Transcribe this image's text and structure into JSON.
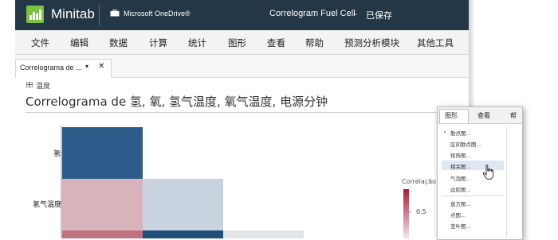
{
  "titlebar": {
    "brand": "Minitab",
    "cloud_label": "Microsoft OneDrive®",
    "doc_title": "Correlogram Fuel Cell",
    "sep": "-",
    "doc_status": "已保存"
  },
  "menu": [
    "文件",
    "编辑",
    "数据",
    "计算",
    "统计",
    "图形",
    "查看",
    "帮助",
    "预测分析模块",
    "其他工具"
  ],
  "tab": {
    "label": "Correlograma de ...",
    "caret": "▾",
    "close": "✕"
  },
  "breadcrumb": "温度",
  "heading": "Correlograma de 氢, 氧, 氢气温度, 氧气温度, 电源分钟",
  "chart": {
    "row_labels": [
      "氢",
      "氢气温度"
    ],
    "legend_title": "Correlação",
    "legend_tick": "0.5",
    "colors": {
      "dark_blue": "#2e5c8a",
      "pink": "#d9b3bc",
      "light_blue": "#c9d3df",
      "red": "#c07282",
      "navy": "#1f4e7a",
      "pale": "#e1e4e8"
    }
  },
  "popup": {
    "tabs": [
      "图形",
      "查看",
      "帮"
    ],
    "items": [
      "散点图...",
      "区间散点图...",
      "矩阵图...",
      "相关图...",
      "气泡图...",
      "边际图...",
      "直方图...",
      "点图...",
      "茎叶图..."
    ],
    "hovered": "相关图..."
  }
}
